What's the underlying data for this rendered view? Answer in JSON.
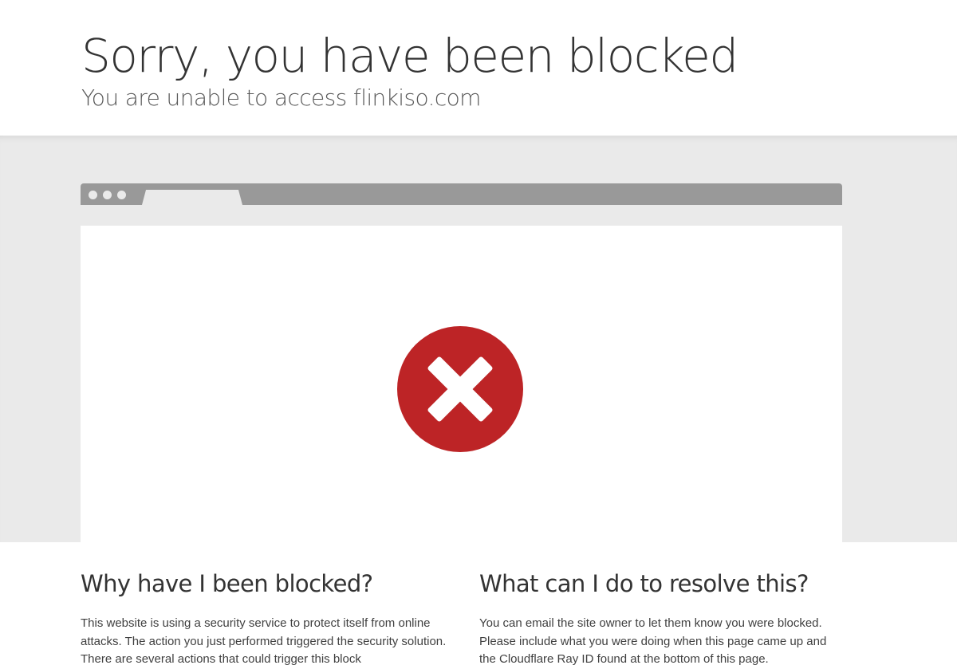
{
  "header": {
    "title": "Sorry, you have been blocked",
    "subtitle": "You are unable to access flinkiso.com"
  },
  "illustration": {
    "icon": "blocked-x-icon",
    "icon_color": "#bd2426",
    "bar_color": "#999999",
    "band_color": "#eaeaea"
  },
  "why": {
    "heading": "Why have I been blocked?",
    "body": "This website is using a security service to protect itself from online attacks. The action you just performed triggered the security solution. There are several actions that could trigger this block"
  },
  "resolve": {
    "heading": "What can I do to resolve this?",
    "body": "You can email the site owner to let them know you were blocked. Please include what you were doing when this page came up and the Cloudflare Ray ID found at the bottom of this page."
  }
}
